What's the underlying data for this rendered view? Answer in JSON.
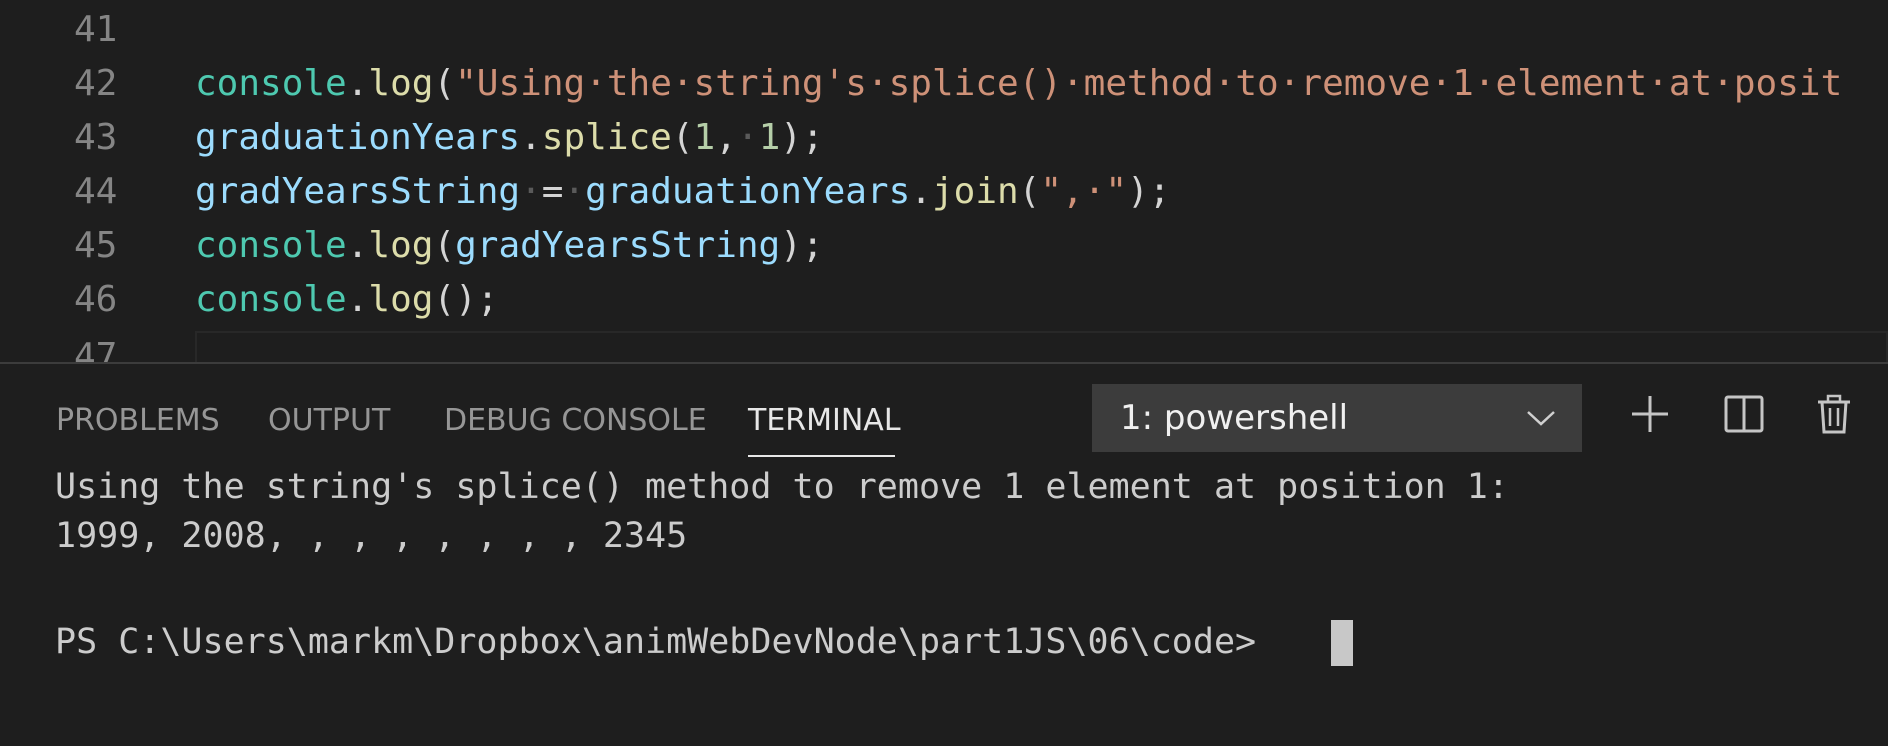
{
  "editor": {
    "lines": [
      {
        "number": "41"
      },
      {
        "number": "42"
      },
      {
        "number": "43"
      },
      {
        "number": "44"
      },
      {
        "number": "45"
      },
      {
        "number": "46"
      },
      {
        "number": "47"
      }
    ],
    "tokens": {
      "console": "console",
      "dot": ".",
      "log": "log",
      "paren_open": "(",
      "line42_string": "\"Using·the·string's·splice()·method·to·remove·1·element·at·posit",
      "graduationYears": "graduationYears",
      "splice": "splice",
      "num1a": "1",
      "comma": ",",
      "space": "·",
      "num1b": "1",
      "close_semi": ");",
      "gradYearsString": "gradYearsString",
      "equals": "=",
      "join": "join",
      "join_string": "\",·\"",
      "empty_call": "();"
    }
  },
  "panel": {
    "tabs": {
      "problems": "PROBLEMS",
      "output": "OUTPUT",
      "debug_console": "DEBUG CONSOLE",
      "terminal": "TERMINAL"
    },
    "active_tab": "TERMINAL",
    "terminal_select": "1: powershell",
    "icons": {
      "new_terminal": "plus-icon",
      "split_terminal": "split-icon",
      "kill_terminal": "trash-icon",
      "dropdown": "chevron-down-icon"
    }
  },
  "terminal": {
    "line1": "Using the string's splice() method to remove 1 element at position 1:",
    "line2": "1999, 2008, , , , , , , , 2345",
    "prompt": "PS C:\\Users\\markm\\Dropbox\\animWebDevNode\\part1JS\\06\\code>"
  },
  "colors": {
    "background": "#1e1e1e",
    "line_number": "#858585",
    "object": "#4ec9b0",
    "function": "#dcdcaa",
    "variable": "#9cdcfe",
    "string": "#ce9178",
    "number": "#b5cea8",
    "terminal_text": "#cccccc",
    "tab_inactive": "#969696",
    "tab_active": "#e7e7e7",
    "select_bg": "#3c3c3c"
  }
}
